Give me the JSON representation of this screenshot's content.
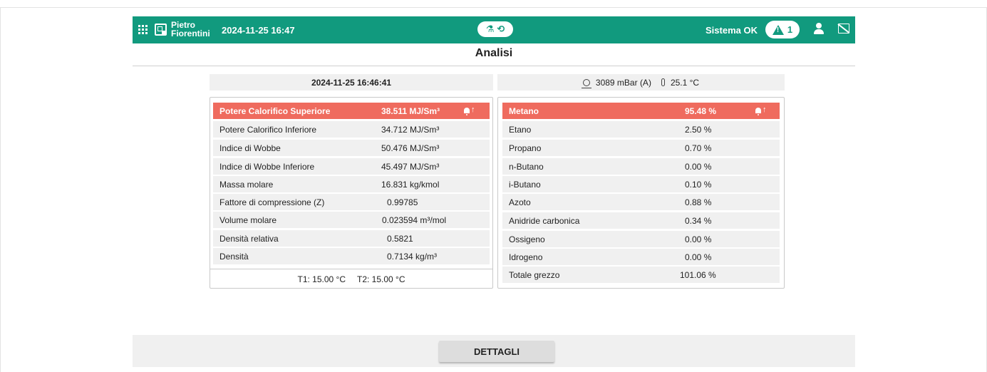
{
  "header": {
    "brand_line1": "Pietro",
    "brand_line2": "Fiorentini",
    "datetime": "2024-11-25 16:47",
    "status_text": "Sistema OK",
    "alarm_count": "1",
    "accent_color": "#119a7e"
  },
  "page": {
    "title": "Analisi"
  },
  "analysis": {
    "timestamp": "2024-11-25 16:46:41",
    "pressure": "3089 mBar (A)",
    "temperature": "25.1 °C"
  },
  "properties": [
    {
      "label": "Potere Calorifico Superiore",
      "value": "38.511 MJ/Sm³",
      "alarm": true
    },
    {
      "label": "Potere Calorifico Inferiore",
      "value": "34.712 MJ/Sm³",
      "alarm": false
    },
    {
      "label": "Indice di Wobbe",
      "value": "50.476 MJ/Sm³",
      "alarm": false
    },
    {
      "label": "Indice di Wobbe Inferiore",
      "value": "45.497 MJ/Sm³",
      "alarm": false
    },
    {
      "label": "Massa molare",
      "value": "16.831 kg/kmol",
      "alarm": false
    },
    {
      "label": "Fattore di compressione (Z)",
      "value": "0.99785",
      "alarm": false
    },
    {
      "label": "Volume molare",
      "value": "0.023594 m³/mol",
      "alarm": false
    },
    {
      "label": "Densità relativa",
      "value": "0.5821",
      "alarm": false
    },
    {
      "label": "Densità",
      "value": "0.7134 kg/m³",
      "alarm": false
    }
  ],
  "temps": {
    "t1": "T1: 15.00 °C",
    "t2": "T2: 15.00 °C"
  },
  "composition": [
    {
      "label": "Metano",
      "value": "95.48 %",
      "alarm": true
    },
    {
      "label": "Etano",
      "value": "2.50 %",
      "alarm": false
    },
    {
      "label": "Propano",
      "value": "0.70 %",
      "alarm": false
    },
    {
      "label": "n-Butano",
      "value": "0.00 %",
      "alarm": false
    },
    {
      "label": "i-Butano",
      "value": "0.10 %",
      "alarm": false
    },
    {
      "label": "Azoto",
      "value": "0.88 %",
      "alarm": false
    },
    {
      "label": "Anidride carbonica",
      "value": "0.34 %",
      "alarm": false
    },
    {
      "label": "Ossigeno",
      "value": "0.00 %",
      "alarm": false
    },
    {
      "label": "Idrogeno",
      "value": "0.00 %",
      "alarm": false
    },
    {
      "label": "Totale grezzo",
      "value": "101.06 %",
      "alarm": false
    }
  ],
  "footer": {
    "details_label": "DETTAGLI"
  },
  "alarm_color": "#ef6b5e"
}
